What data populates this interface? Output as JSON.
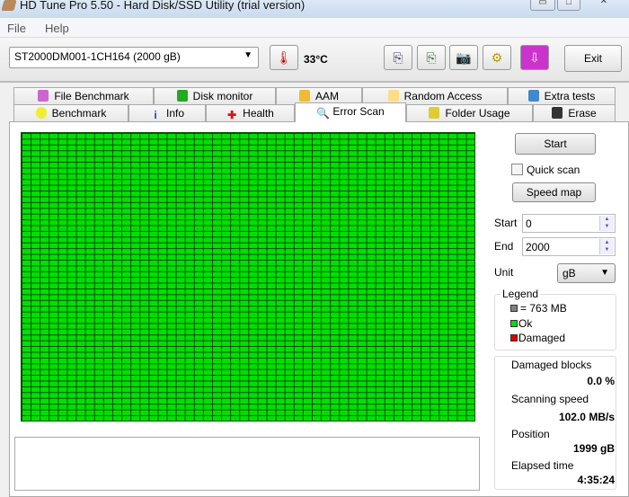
{
  "window": {
    "title": "HD Tune Pro 5.50 - Hard Disk/SSD Utility (trial version)"
  },
  "menu": [
    "File",
    "Help"
  ],
  "toolbar": {
    "drive": "ST2000DM001-1CH164 (2000 gB)",
    "temperature": "33°C",
    "exit": "Exit"
  },
  "tabs_top": [
    "File Benchmark",
    "Disk monitor",
    "AAM",
    "Random Access",
    "Extra tests"
  ],
  "tabs_bottom": [
    "Benchmark",
    "Info",
    "Health",
    "Error Scan",
    "Folder Usage",
    "Erase"
  ],
  "side": {
    "start_button": "Start",
    "quick_scan": "Quick scan",
    "speed_map": "Speed map",
    "start_label": "Start",
    "start_value": "0",
    "end_label": "End",
    "end_value": "2000",
    "unit_label": "Unit",
    "unit_value": "gB"
  },
  "legend": {
    "title": "Legend",
    "block": "= 763 MB",
    "ok": "Ok",
    "damaged": "Damaged",
    "colors": {
      "block": "#808080",
      "ok": "#00e000",
      "damaged": "#e00000"
    }
  },
  "stats": {
    "damaged_label": "Damaged blocks",
    "damaged_value": "0.0 %",
    "speed_label": "Scanning speed",
    "speed_value": "102.0 MB/s",
    "position_label": "Position",
    "position_value": "1999 gB",
    "elapsed_label": "Elapsed time",
    "elapsed_value": "4:35:24"
  }
}
